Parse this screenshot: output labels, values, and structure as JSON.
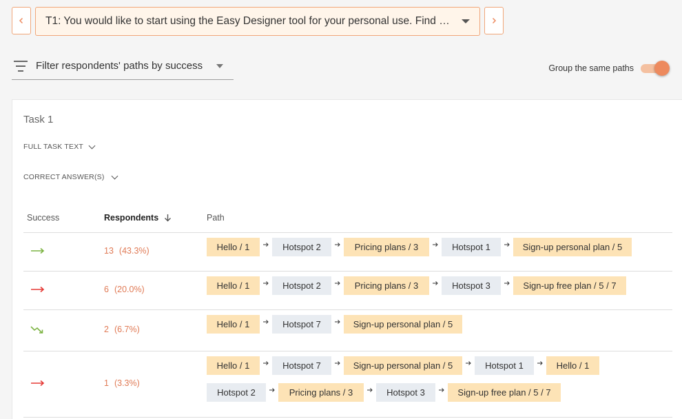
{
  "task_selector": {
    "text": "T1: You would like to start using the Easy Designer tool for your personal use. Find ou…"
  },
  "filter": {
    "label": "Filter respondents' paths by success"
  },
  "group_toggle": {
    "label": "Group the same paths",
    "on": true
  },
  "panel": {
    "task_title": "Task 1",
    "full_task_text": "FULL TASK TEXT",
    "correct_answers": "CORRECT ANSWER(S)"
  },
  "table": {
    "col_success": "Success",
    "col_respondents": "Respondents",
    "col_path": "Path",
    "rows": [
      {
        "status": "direct-success",
        "count": "13",
        "pct": "(43.3%)",
        "steps": [
          "Hello / 1",
          "Hotspot 2",
          "Pricing plans / 3",
          "Hotspot 1",
          "Sign-up personal plan / 5"
        ]
      },
      {
        "status": "failure",
        "count": "6",
        "pct": "(20.0%)",
        "steps": [
          "Hello / 1",
          "Hotspot 2",
          "Pricing plans / 3",
          "Hotspot 3",
          "Sign-up free plan / 5 / 7"
        ]
      },
      {
        "status": "indirect-success",
        "count": "2",
        "pct": "(6.7%)",
        "steps": [
          "Hello / 1",
          "Hotspot 7",
          "Sign-up personal plan / 5"
        ]
      },
      {
        "status": "failure",
        "count": "1",
        "pct": "(3.3%)",
        "steps": [
          "Hello / 1",
          "Hotspot 7",
          "Sign-up personal plan / 5",
          "Hotspot 1",
          "Hello / 1",
          "Hotspot 2",
          "Pricing plans / 3",
          "Hotspot 3",
          "Sign-up free plan / 5 / 7"
        ]
      }
    ]
  },
  "colors": {
    "accent": "#f0a679",
    "success": "#7cb342",
    "failure": "#e53935",
    "page_chip": "#fde3b6",
    "hotspot_chip": "#e8ecf1",
    "respondents_text": "#e07a55"
  }
}
